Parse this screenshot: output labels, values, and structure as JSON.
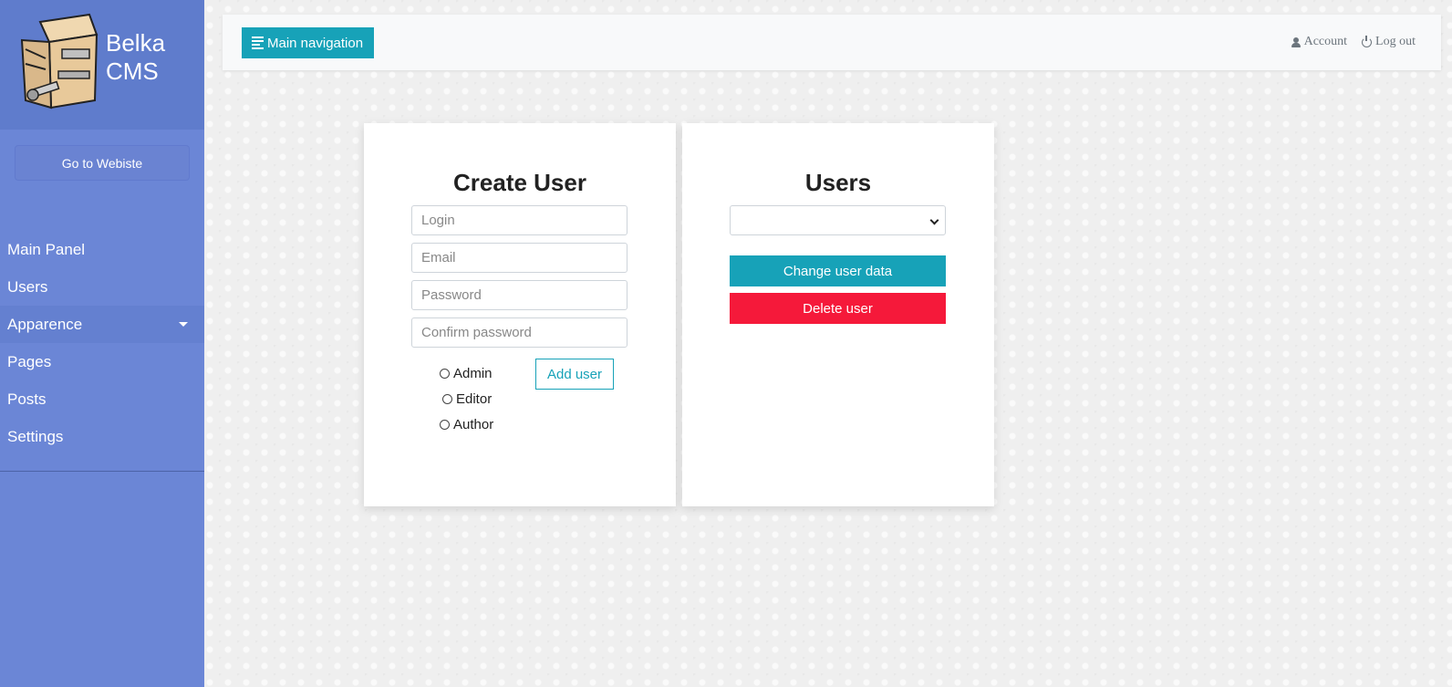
{
  "sidebar": {
    "brand": {
      "line1": "Belka",
      "line2": "CMS"
    },
    "goto_label": "Go to Webiste",
    "items": [
      {
        "label": "Main Panel"
      },
      {
        "label": "Users"
      },
      {
        "label": "Apparence",
        "has_submenu": true,
        "active": true
      },
      {
        "label": "Pages"
      },
      {
        "label": "Posts"
      },
      {
        "label": "Settings"
      }
    ]
  },
  "topbar": {
    "main_nav_label": "Main navigation",
    "account_label": "Account",
    "logout_label": "Log out"
  },
  "create_user": {
    "title": "Create User",
    "fields": {
      "login": {
        "placeholder": "Login",
        "value": ""
      },
      "email": {
        "placeholder": "Email",
        "value": ""
      },
      "password": {
        "placeholder": "Password",
        "value": ""
      },
      "confirm": {
        "placeholder": "Confirm password",
        "value": ""
      }
    },
    "roles": [
      "Admin",
      "Editor",
      "Author"
    ],
    "add_label": "Add user"
  },
  "users": {
    "title": "Users",
    "selected": "",
    "change_label": "Change user data",
    "delete_label": "Delete user"
  },
  "colors": {
    "sidebar": "#6b86d6",
    "accent": "#17a2b8",
    "danger": "#f5193a"
  }
}
